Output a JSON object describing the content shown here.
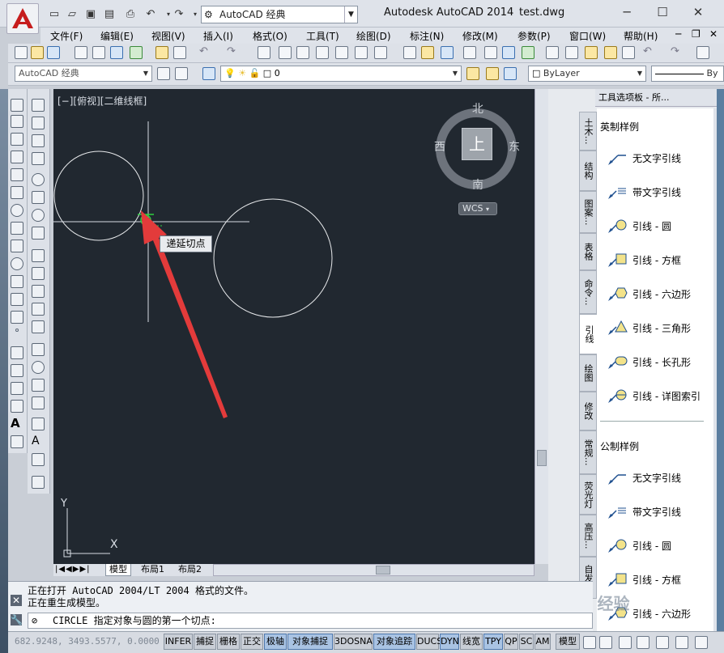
{
  "window": {
    "app_title": "Autodesk AutoCAD 2014",
    "file_title": "test.dwg",
    "workspace": "AutoCAD 经典"
  },
  "menu": [
    "文件(F)",
    "编辑(E)",
    "视图(V)",
    "插入(I)",
    "格式(O)",
    "工具(T)",
    "绘图(D)",
    "标注(N)",
    "修改(M)",
    "参数(P)",
    "窗口(W)",
    "帮助(H)"
  ],
  "toolbar2": {
    "workspace": "AutoCAD 经典",
    "layer": "0",
    "color": "ByLayer",
    "linetype_prefix": "By"
  },
  "canvas": {
    "view_label": "[−][俯视][二维线框]",
    "tooltip": "递延切点",
    "viewcube": {
      "top": "上",
      "north": "北",
      "south": "南",
      "east": "东",
      "west": "西",
      "wcs": "WCS"
    },
    "ucs_x": "X",
    "ucs_y": "Y"
  },
  "layout_tabs": [
    "模型",
    "布局1",
    "布局2"
  ],
  "command": {
    "history": [
      "正在打开 AutoCAD 2004/LT 2004 格式的文件。",
      "正在重生成模型。"
    ],
    "prompt": "CIRCLE 指定对象与圆的第一个切点:"
  },
  "status": {
    "coords": "682.9248, 3493.5577, 0.0000",
    "buttons": [
      "INFER",
      "捕捉",
      "栅格",
      "正交",
      "极轴",
      "对象捕捉",
      "3DOSNAP",
      "对象追踪",
      "DUCS",
      "DYN",
      "线宽",
      "TPY",
      "QP",
      "SC",
      "AM"
    ],
    "model": "模型"
  },
  "palette": {
    "title": "工具选项板 - 所...",
    "tabs": [
      "土木...",
      "结构",
      "图案...",
      "表格",
      "命令...",
      "引线",
      "绘图",
      "修改",
      "常规...",
      "荧光灯",
      "高压...",
      "自发光"
    ],
    "active_tab": "引线",
    "section1": "英制样例",
    "section2": "公制样例",
    "items1": [
      "无文字引线",
      "带文字引线",
      "引线 - 圆",
      "引线 - 方框",
      "引线 - 六边形",
      "引线 - 三角形",
      "引线 - 长孔形",
      "引线 - 详图索引"
    ],
    "items2": [
      "无文字引线",
      "带文字引线",
      "引线 - 圆",
      "引线 - 方框",
      "引线 - 六边形"
    ]
  },
  "colors": {
    "canvas_bg": "#212830",
    "arrow": "#e33b3b",
    "snap_marker": "#2fcf3f"
  },
  "watermark": "Bai 经验"
}
